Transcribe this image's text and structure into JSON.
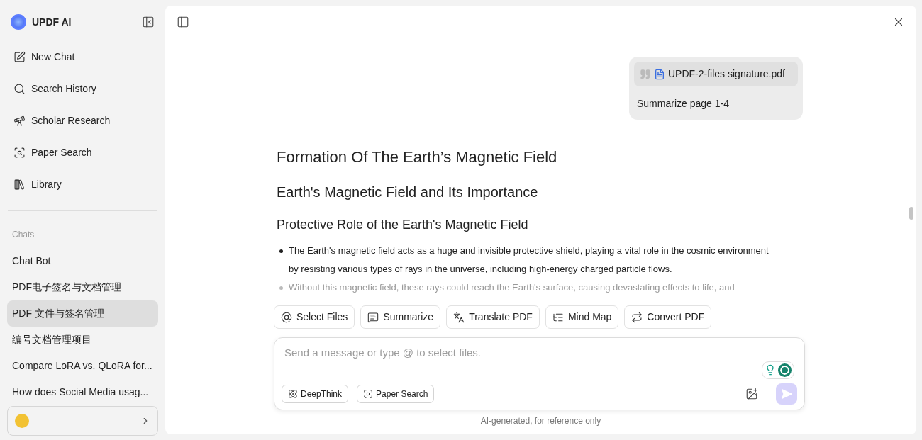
{
  "sidebar": {
    "brand": "UPDF AI",
    "nav": [
      {
        "kind": "new",
        "label": "New Chat"
      },
      {
        "kind": "search",
        "label": "Search History"
      },
      {
        "kind": "scholar",
        "label": "Scholar Research"
      },
      {
        "kind": "paper",
        "label": "Paper Search"
      },
      {
        "kind": "library",
        "label": "Library"
      }
    ],
    "chats_heading": "Chats",
    "chats": [
      {
        "label": "Chat Bot",
        "selected": false
      },
      {
        "label": "PDF电子签名与文档管理",
        "selected": false
      },
      {
        "label": "PDF 文件与签名管理",
        "selected": true
      },
      {
        "label": "编号文档管理项目",
        "selected": false
      },
      {
        "label": "Compare LoRA vs. QLoRA for...",
        "selected": false
      },
      {
        "label": "How does Social Media usag...",
        "selected": false
      }
    ]
  },
  "user_message": {
    "file": "UPDF-2-files signature.pdf",
    "text": "Summarize page 1-4"
  },
  "answer": {
    "title": "Formation Of The Earth’s Magnetic Field",
    "heading": "Earth's Magnetic Field and Its Importance",
    "subheading": "Protective Role of the Earth's Magnetic Field",
    "bullets": [
      {
        "text": "The Earth's magnetic field acts as a huge and invisible protective shield, playing a vital role in the cosmic environment by resisting various types of rays in the universe, including high-energy charged particle flows.",
        "faded": false
      },
      {
        "text": "Without this magnetic field, these rays could reach the Earth's surface, causing devastating effects to life, and",
        "faded": true
      }
    ]
  },
  "tools": [
    {
      "kind": "select",
      "label": "Select Files"
    },
    {
      "kind": "summarize",
      "label": "Summarize"
    },
    {
      "kind": "translate",
      "label": "Translate PDF"
    },
    {
      "kind": "mindmap",
      "label": "Mind Map"
    },
    {
      "kind": "convert",
      "label": "Convert PDF"
    }
  ],
  "composer": {
    "placeholder": "Send a message or type @ to select files.",
    "options": [
      {
        "kind": "deepthink",
        "label": "DeepThink"
      },
      {
        "kind": "paper",
        "label": "Paper Search"
      }
    ]
  },
  "footer": "AI-generated, for reference only"
}
